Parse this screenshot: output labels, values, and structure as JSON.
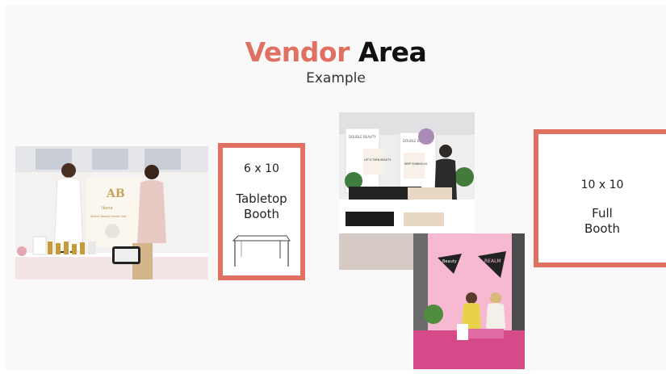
{
  "slide": {
    "title_accent": "Vendor",
    "title_rest": "Area",
    "subtitle": "Example"
  },
  "tabletop": {
    "size": "6 x 10",
    "label_line1": "Tabletop",
    "label_line2": "Booth"
  },
  "full": {
    "size": "10 x 10",
    "label_line1": "Full",
    "label_line2": "Booth"
  },
  "photos": {
    "booth1_banner": "Ikona",
    "booth1_sub": "Where Beauty meets Self",
    "booth2_left_banner": "DOUBLE BEAUTY",
    "booth2_right_banner": "DOUBLE BEAUTY",
    "booth2_sign1": "LET'S TURN BEAUTY",
    "booth2_sign2": "KEEP SHINING IN",
    "booth3_sign1": "Beauty",
    "booth3_sign2": "REALM"
  },
  "colors": {
    "accent": "#e07062",
    "background": "#f9f9f9"
  }
}
